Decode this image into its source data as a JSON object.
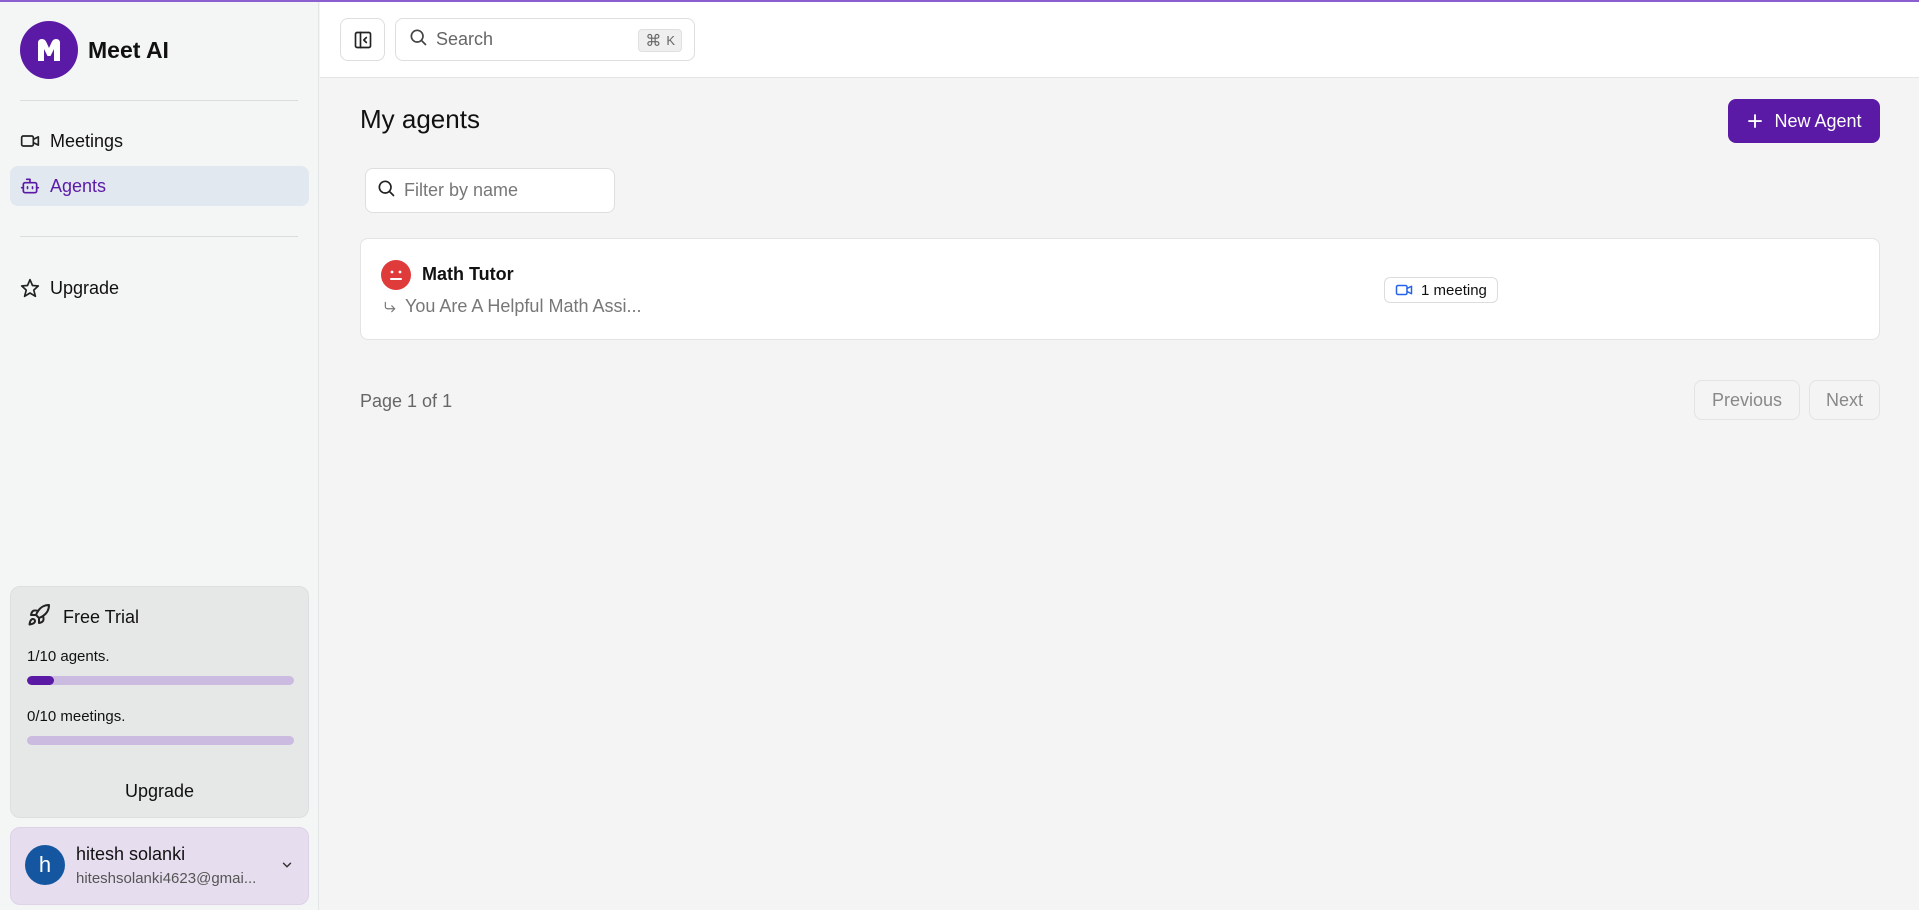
{
  "app": {
    "name": "Meet AI",
    "logo_letter": "M",
    "accent_color": "#5b1aa6"
  },
  "sidebar": {
    "nav": [
      {
        "label": "Meetings",
        "icon": "video-icon",
        "active": false
      },
      {
        "label": "Agents",
        "icon": "bot-icon",
        "active": true
      }
    ],
    "upgrade_label": "Upgrade",
    "upgrade_icon": "star-icon"
  },
  "trial": {
    "title": "Free Trial",
    "icon": "rocket-icon",
    "agents_text": "1/10 agents.",
    "agents_progress": 0.1,
    "meetings_text": "0/10 meetings.",
    "meetings_progress": 0,
    "upgrade_label": "Upgrade"
  },
  "user": {
    "initial": "h",
    "name": "hitesh solanki",
    "email": "hiteshsolanki4623@gmai...",
    "avatar_color": "#1457a0"
  },
  "topbar": {
    "search_placeholder": "Search",
    "shortcut_symbol": "⌘",
    "shortcut_key": "K"
  },
  "main": {
    "title": "My agents",
    "new_agent_label": "New Agent",
    "filter_placeholder": "Filter by name",
    "agents": [
      {
        "name": "Math Tutor",
        "description": "You Are A Helpful Math Assi...",
        "meetings": "1 meeting",
        "avatar_color": "#e03b3b"
      }
    ],
    "pagination": {
      "text": "Page 1 of 1",
      "previous_label": "Previous",
      "next_label": "Next"
    }
  }
}
